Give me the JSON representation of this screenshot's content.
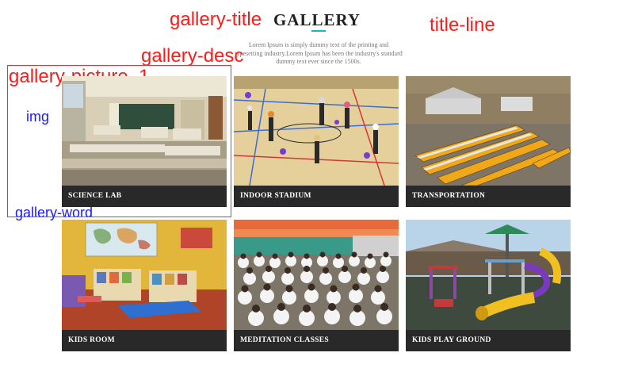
{
  "annotations": {
    "gallery_title": "gallery-title",
    "title_line": "title-line",
    "gallery_desc": "gallery-desc",
    "gallery_picture": "gallery-picture_1",
    "img": "img",
    "gallery_word": "gallery-word"
  },
  "gallery": {
    "title": "GALLERY",
    "description": "Lorem Ipsum is simply dummy text of the printing and typesetting industry.Lorem Ipsum has been the industry's standard dummy text ever since the 1500s.",
    "items": [
      {
        "label": "SCIENCE LAB"
      },
      {
        "label": "INDOOR STADIUM"
      },
      {
        "label": "TRANSPORTATION"
      },
      {
        "label": "KIDS ROOM"
      },
      {
        "label": "MEDITATION CLASSES"
      },
      {
        "label": "KIDS PLAY GROUND"
      }
    ]
  },
  "colors": {
    "annotation_red": "#ff1a1a",
    "annotation_blue": "#1a1aff",
    "title_line": "#1bb3c4",
    "caption_bg": "#2a2a2a"
  }
}
